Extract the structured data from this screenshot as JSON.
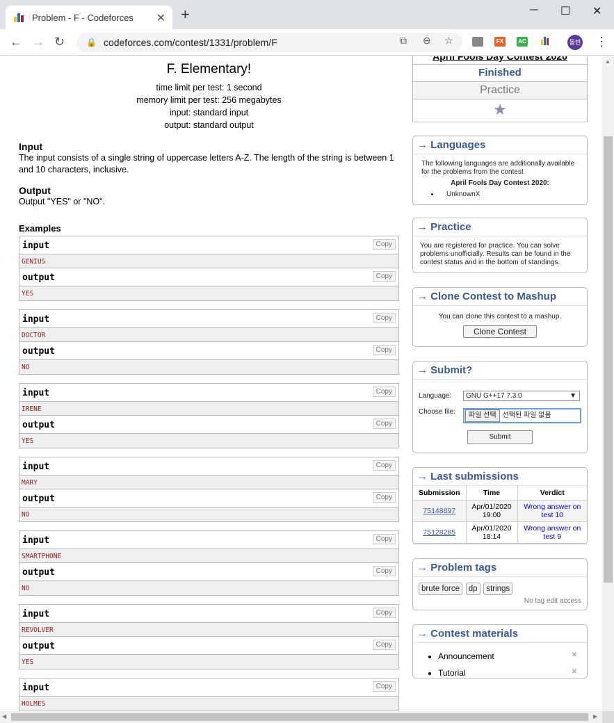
{
  "browser": {
    "tab_title": "Problem - F - Codeforces",
    "url": "codeforces.com/contest/1331/problem/F",
    "profile_initials": "동빈",
    "ext_fx": "FX",
    "ext_ac": "AC"
  },
  "problem": {
    "title": "F. Elementary!",
    "time_limit": "time limit per test: 1 second",
    "memory_limit": "memory limit per test: 256 megabytes",
    "input_src": "input: standard input",
    "output_src": "output: standard output",
    "input_title": "Input",
    "input_text": "The input consists of a single string of uppercase letters A-Z. The length of the string is between 1 and 10 characters, inclusive.",
    "output_title": "Output",
    "output_text": "Output \"YES\" or \"NO\".",
    "examples_title": "Examples",
    "input_label": "input",
    "output_label": "output",
    "copy_label": "Copy",
    "examples": [
      {
        "input": "GENIUS",
        "output": "YES"
      },
      {
        "input": "DOCTOR",
        "output": "NO"
      },
      {
        "input": "IRENE",
        "output": "YES"
      },
      {
        "input": "MARY",
        "output": "NO"
      },
      {
        "input": "SMARTPHONE",
        "output": "NO"
      },
      {
        "input": "REVOLVER",
        "output": "YES"
      },
      {
        "input": "HOLMES",
        "output": ""
      }
    ]
  },
  "sidebar": {
    "contest_name": "April Fools Day Contest 2020",
    "status": "Finished",
    "phase": "Practice",
    "languages": {
      "title": "→ Languages",
      "text": "The following languages are additionally available for the problems from the contest",
      "contest": "April Fools Day Contest 2020:",
      "items": [
        "UnknownX"
      ]
    },
    "practice": {
      "title": "→ Practice",
      "text": "You are registered for practice. You can solve problems unofficially. Results can be found in the contest status and in the bottom of standings."
    },
    "clone": {
      "title": "→ Clone Contest to Mashup",
      "text": "You can clone this contest to a mashup.",
      "button": "Clone Contest"
    },
    "submit": {
      "title": "→ Submit?",
      "language_label": "Language:",
      "language_value": "GNU G++17 7.3.0",
      "file_label": "Choose file:",
      "file_button": "파일 선택",
      "file_status": "선택된 파일 없음",
      "submit_button": "Submit"
    },
    "last_submissions": {
      "title": "→ Last submissions",
      "headers": [
        "Submission",
        "Time",
        "Verdict"
      ],
      "rows": [
        {
          "id": "75148897",
          "time": "Apr/01/2020 19:00",
          "verdict": "Wrong answer on test 10"
        },
        {
          "id": "75128285",
          "time": "Apr/01/2020 18:14",
          "verdict": "Wrong answer on test 9"
        }
      ]
    },
    "tags": {
      "title": "→ Problem tags",
      "items": [
        "brute force",
        "dp",
        "strings"
      ],
      "note": "No tag edit access"
    },
    "materials": {
      "title": "→ Contest materials",
      "items": [
        "Announcement",
        "Tutorial"
      ]
    }
  },
  "colors": {
    "link": "#3b5998",
    "title": "#3b5998",
    "verdict": "#0000cc"
  }
}
